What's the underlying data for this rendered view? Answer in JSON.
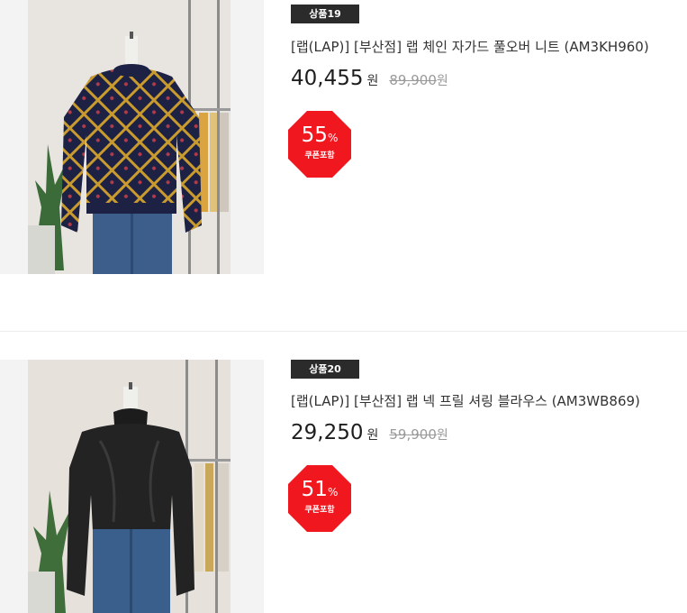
{
  "products": [
    {
      "tag": "상품19",
      "title": "[랩(LAP)] [부산점] 랩 체인 자가드 풀오버 니트 (AM3KH960)",
      "price": "40,455",
      "currency": "원",
      "original_price": "89,900",
      "original_currency": "원",
      "discount": "55",
      "percent_sign": "%",
      "coupon_label": "쿠폰포함"
    },
    {
      "tag": "상품20",
      "title": "[랩(LAP)] [부산점] 랩 넥 프릴 셔링 블라우스 (AM3WB869)",
      "price": "29,250",
      "currency": "원",
      "original_price": "59,900",
      "original_currency": "원",
      "discount": "51",
      "percent_sign": "%",
      "coupon_label": "쿠폰포함"
    }
  ],
  "colors": {
    "badge_red": "#f0171f",
    "tag_bg": "#2b2b2b",
    "price_text": "#1e1e1e",
    "original_price_text": "#9a9a9a"
  }
}
